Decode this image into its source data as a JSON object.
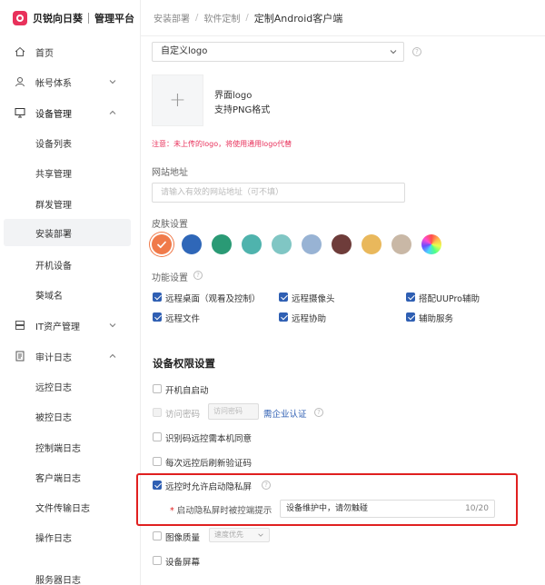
{
  "brand": {
    "name": "贝锐向日葵",
    "subtitle": "管理平台"
  },
  "sidebar": {
    "items": [
      {
        "label": "首页",
        "icon": "home-icon"
      },
      {
        "label": "帐号体系",
        "icon": "user-icon"
      },
      {
        "label": "设备管理",
        "icon": "monitor-icon"
      },
      {
        "label": "设备列表"
      },
      {
        "label": "共享管理"
      },
      {
        "label": "群发管理"
      },
      {
        "label": "安装部署"
      },
      {
        "label": "开机设备"
      },
      {
        "label": "葵域名"
      },
      {
        "label": "IT资产管理",
        "icon": "server-icon"
      },
      {
        "label": "审计日志",
        "icon": "log-icon"
      },
      {
        "label": "远控日志"
      },
      {
        "label": "被控日志"
      },
      {
        "label": "控制端日志"
      },
      {
        "label": "客户端日志"
      },
      {
        "label": "文件传输日志"
      },
      {
        "label": "操作日志"
      },
      {
        "label": "服务器日志"
      }
    ]
  },
  "breadcrumb": {
    "items": [
      "安装部署",
      "软件定制"
    ],
    "current": "定制Android客户端"
  },
  "logo_setting": {
    "select_value": "自定义logo",
    "upload_plus": "+",
    "title": "界面logo",
    "format": "支持PNG格式",
    "warning": "注意：未上传的logo，将使用通用logo代替"
  },
  "website": {
    "label": "网站地址",
    "placeholder": "请输入有效的网站地址（可不填）"
  },
  "skin": {
    "label": "皮肤设置",
    "colors": [
      "#f07a4a",
      "#2f67b8",
      "#2a9a75",
      "#4fb3ad",
      "#80c6c4",
      "#98b3d4",
      "#6e3c3a",
      "#e9b85c",
      "#c9b8a6"
    ]
  },
  "features": {
    "label": "功能设置",
    "items": [
      {
        "label": "远程桌面（观看及控制）",
        "checked": true
      },
      {
        "label": "远程摄像头",
        "checked": true
      },
      {
        "label": "搭配UUPro辅助",
        "checked": true
      },
      {
        "label": "远程文件",
        "checked": true
      },
      {
        "label": "远程协助",
        "checked": true
      },
      {
        "label": "辅助服务",
        "checked": true
      }
    ]
  },
  "permissions": {
    "title": "设备权限设置",
    "autostart": "开机自启动",
    "access_password": "访问密码",
    "access_password_placeholder": "访问密码",
    "enterprise_link": "需企业认证",
    "identify_confirm": "识别码远控需本机同意",
    "reverify": "每次远控后刷新验证码",
    "privacy_screen": "远控时允许启动隐私屏",
    "privacy_prompt_label": "启动隐私屏时被控端提示",
    "privacy_prompt_value": "设备维护中，请勿触碰",
    "privacy_prompt_count": "10/20",
    "image_quality": "图像质量",
    "image_quality_option": "速度优先",
    "screen_lock": "设备屏幕"
  }
}
